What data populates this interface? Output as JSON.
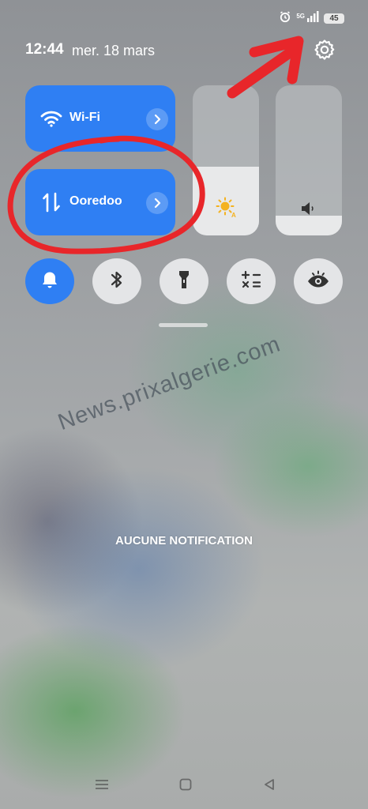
{
  "status_bar": {
    "network_label": "5G",
    "battery_level": "45",
    "icons": [
      "alarm-icon",
      "signal-icon",
      "battery-icon"
    ]
  },
  "header": {
    "time": "12:44",
    "date": "mer. 18 mars",
    "settings_icon": "gear-icon"
  },
  "tiles": {
    "wifi": {
      "label": "Wi-Fi",
      "icon": "wifi-icon",
      "active": true
    },
    "mobile_data": {
      "label": "Ooredoo",
      "icon": "data-arrows-icon",
      "active": true
    }
  },
  "sliders": {
    "brightness": {
      "icon": "sun-auto-icon",
      "level": 0.46
    },
    "volume": {
      "icon": "speaker-icon",
      "level": 0.13
    }
  },
  "toggles": [
    {
      "name": "bell",
      "icon": "bell-icon",
      "active": true
    },
    {
      "name": "bluetooth",
      "icon": "bluetooth-icon",
      "active": false
    },
    {
      "name": "flashlight",
      "icon": "flashlight-icon",
      "active": false
    },
    {
      "name": "calculator",
      "icon": "calculator-icon",
      "active": false
    },
    {
      "name": "eye-comfort",
      "icon": "eye-icon",
      "active": false
    }
  ],
  "notifications": {
    "empty_text": "AUCUNE NOTIFICATION"
  },
  "watermark": "News.prixalgerie.com",
  "nav_bar": [
    "menu-icon",
    "home-icon",
    "back-icon"
  ],
  "colors": {
    "accent": "#2f7ff3",
    "annotation": "#e8262a",
    "toggle_bg": "#e4e5e7"
  }
}
